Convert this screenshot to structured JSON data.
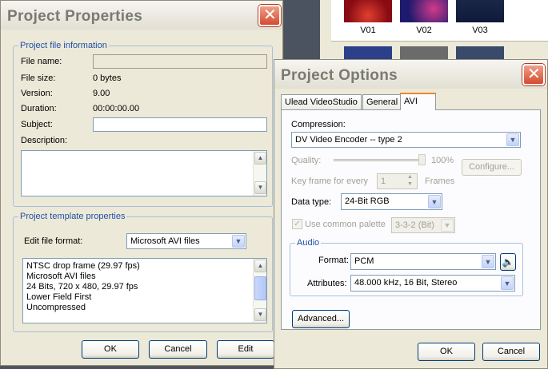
{
  "background": {
    "thumbnails": [
      {
        "label": "V01",
        "color": "#a8141a"
      },
      {
        "label": "V02",
        "color": "#1e1a6e"
      },
      {
        "label": "V03",
        "color": "#0f1a3a"
      }
    ]
  },
  "project_properties": {
    "title": "Project Properties",
    "file_info": {
      "legend": "Project file information",
      "file_name_label": "File name:",
      "file_name_value": "",
      "file_size_label": "File size:",
      "file_size_value": "0 bytes",
      "version_label": "Version:",
      "version_value": "9.00",
      "duration_label": "Duration:",
      "duration_value": "00:00:00.00",
      "subject_label": "Subject:",
      "subject_value": "",
      "description_label": "Description:",
      "description_value": ""
    },
    "template": {
      "legend": "Project template properties",
      "edit_format_label": "Edit file format:",
      "edit_format_value": "Microsoft AVI files",
      "details": [
        "NTSC drop frame (29.97 fps)",
        "Microsoft AVI files",
        "24 Bits, 720 x 480, 29.97 fps",
        "Lower Field First",
        "Uncompressed"
      ]
    },
    "buttons": {
      "ok": "OK",
      "cancel": "Cancel",
      "edit": "Edit"
    }
  },
  "project_options": {
    "title": "Project Options",
    "tabs": [
      "Ulead VideoStudio",
      "General",
      "AVI"
    ],
    "active_tab": "AVI",
    "compression_label": "Compression:",
    "compression_value": "DV Video Encoder -- type 2",
    "quality_label": "Quality:",
    "quality_value": "100%",
    "keyframe_label": "Key frame for every",
    "keyframe_value": "1",
    "keyframe_unit": "Frames",
    "configure_label": "Configure...",
    "data_type_label": "Data type:",
    "data_type_value": "24-Bit RGB",
    "use_palette_label": "Use common palette",
    "palette_value": "3-3-2 (Bit)",
    "audio": {
      "legend": "Audio",
      "format_label": "Format:",
      "format_value": "PCM",
      "attributes_label": "Attributes:",
      "attributes_value": "48.000 kHz, 16 Bit, Stereo"
    },
    "advanced_label": "Advanced...",
    "buttons": {
      "ok": "OK",
      "cancel": "Cancel"
    }
  }
}
